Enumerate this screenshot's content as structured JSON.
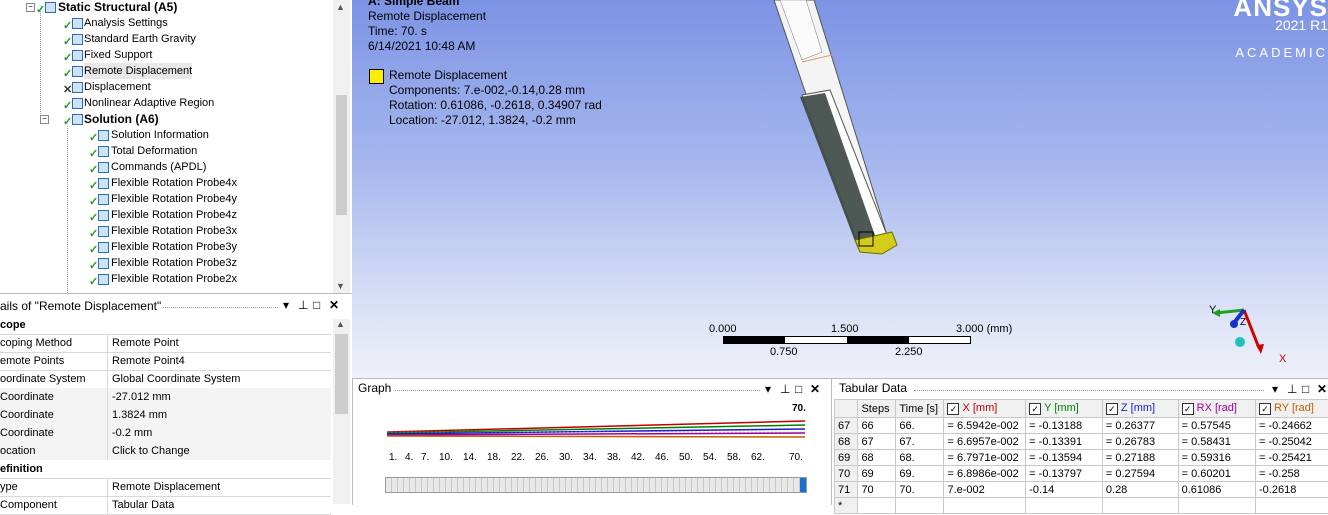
{
  "tree": {
    "items": [
      {
        "label": "Static Structural (A5)",
        "bold": true
      },
      {
        "label": "Analysis Settings"
      },
      {
        "label": "Standard Earth Gravity"
      },
      {
        "label": "Fixed Support"
      },
      {
        "label": "Remote Displacement",
        "selected": true
      },
      {
        "label": "Displacement"
      },
      {
        "label": "Nonlinear Adaptive Region"
      },
      {
        "label": "Solution (A6)",
        "bold": true
      },
      {
        "label": "Solution Information"
      },
      {
        "label": "Total Deformation"
      },
      {
        "label": "Commands (APDL)"
      },
      {
        "label": "Flexible Rotation Probe4x"
      },
      {
        "label": "Flexible Rotation Probe4y"
      },
      {
        "label": "Flexible Rotation Probe4z"
      },
      {
        "label": "Flexible Rotation Probe3x"
      },
      {
        "label": "Flexible Rotation Probe3y"
      },
      {
        "label": "Flexible Rotation Probe3z"
      },
      {
        "label": "Flexible Rotation Probe2x"
      }
    ]
  },
  "details": {
    "title": "ails of \"Remote Displacement\"",
    "rows": [
      {
        "key": "cope",
        "value": "",
        "header": true
      },
      {
        "key": "coping Method",
        "value": "Remote Point"
      },
      {
        "key": "emote Points",
        "value": "Remote Point4"
      },
      {
        "key": "oordinate System",
        "value": "Global Coordinate System"
      },
      {
        "key": " Coordinate",
        "value": "-27.012 mm"
      },
      {
        "key": " Coordinate",
        "value": "1.3824 mm"
      },
      {
        "key": " Coordinate",
        "value": "-0.2 mm"
      },
      {
        "key": "ocation",
        "value": "Click to Change"
      },
      {
        "key": "efinition",
        "value": "",
        "header": true
      },
      {
        "key": "ype",
        "value": "Remote Displacement"
      },
      {
        "key": "Component",
        "value": "Tabular Data"
      }
    ]
  },
  "viewport": {
    "model_title": "A: Simple Beam",
    "object": "Remote Displacement",
    "time": "Time: 70. s",
    "date": "6/14/2021 10:48 AM",
    "legend_name": "Remote Displacement",
    "components": "Components: 7.e-002,-0.14,0.28 mm",
    "rotation": "Rotation: 0.61086, -0.2618, 0.34907 rad",
    "location": "Location: -27.012, 1.3824, -0.2 mm",
    "brand": "ANSYS",
    "version": "2021 R1",
    "edition": "ACADEMIC",
    "scale_top": [
      "0.000",
      "1.500",
      "3.000 (mm)"
    ],
    "scale_bottom": [
      "0.750",
      "2.250"
    ],
    "axis_x": "X",
    "axis_y": "Y",
    "axis_z": "Z",
    "colors": {
      "legend": "#ffee00",
      "axis_x": "#d00000",
      "axis_y": "#20a020",
      "axis_z": "#1a2fd0"
    }
  },
  "graph": {
    "title": "Graph",
    "max_label": "70.",
    "ticks": [
      "1.",
      "4.",
      "7.",
      "10.",
      "14.",
      "18.",
      "22.",
      "26.",
      "30.",
      "34.",
      "38.",
      "42.",
      "46.",
      "50.",
      "54.",
      "58.",
      "62.",
      "70."
    ]
  },
  "tabular": {
    "title": "Tabular Data",
    "headers": [
      "",
      "Steps",
      "Time [s]",
      "X [mm]",
      "Y [mm]",
      "Z [mm]",
      "RX [rad]",
      "RY [rad]"
    ],
    "header_colors": [
      "",
      "",
      "",
      "#c00000",
      "#008000",
      "#1a1ad0",
      "#a000a0",
      "#c06000"
    ],
    "rows": [
      [
        "67",
        "66",
        "66.",
        "= 6.5942e-002",
        "= -0.13188",
        "= 0.26377",
        "= 0.57545",
        "= -0.24662"
      ],
      [
        "68",
        "67",
        "67.",
        "= 6.6957e-002",
        "= -0.13391",
        "= 0.26783",
        "= 0.58431",
        "= -0.25042"
      ],
      [
        "69",
        "68",
        "68.",
        "= 6.7971e-002",
        "= -0.13594",
        "= 0.27188",
        "= 0.59316",
        "= -0.25421"
      ],
      [
        "70",
        "69",
        "69.",
        "= 6.8986e-002",
        "= -0.13797",
        "= 0.27594",
        "= 0.60201",
        "= -0.258"
      ],
      [
        "71",
        "70",
        "70.",
        "7.e-002",
        "-0.14",
        "0.28",
        "0.61086",
        "-0.2618"
      ],
      [
        "*",
        "",
        "",
        "",
        "",
        "",
        "",
        ""
      ]
    ]
  }
}
